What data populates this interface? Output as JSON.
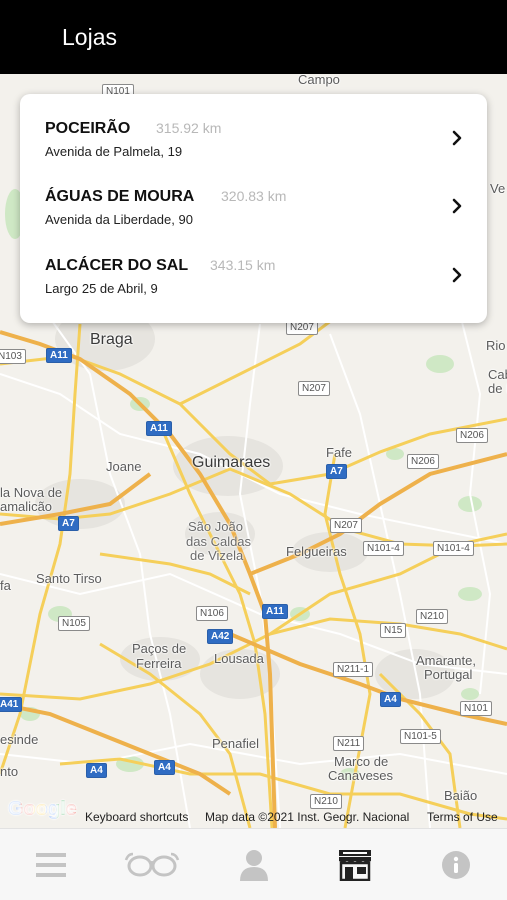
{
  "header": {
    "title": "Lojas"
  },
  "stores": [
    {
      "name": "POCEIRÃO",
      "distance": "315.92 km",
      "address": "Avenida de Palmela, 19"
    },
    {
      "name": "ÁGUAS DE MOURA",
      "distance": "320.83 km",
      "address": "Avenida da Liberdade, 90"
    },
    {
      "name": "ALCÁCER DO SAL",
      "distance": "343.15 km",
      "address": "Largo 25 de Abril, 9"
    }
  ],
  "map": {
    "places": {
      "campo": "Campo",
      "braga": "Braga",
      "guimaraes": "Guimaraes",
      "fafe": "Fafe",
      "joane": "Joane",
      "vila_nova_1": "la Nova de",
      "vila_nova_2": "amalicão",
      "sao_joao_1": "São João",
      "sao_joao_2": "das Caldas",
      "sao_joao_3": "de Vizela",
      "felgueiras": "Felgueiras",
      "santo_tirso": "Santo Tirso",
      "pacos_1": "Paços de",
      "pacos_2": "Ferreira",
      "lousada": "Lousada",
      "amarante_1": "Amarante,",
      "amarante_2": "Portugal",
      "penafiel": "Penafiel",
      "marco_1": "Marco de",
      "marco_2": "Canaveses",
      "baiao": "Baião",
      "rio": "Rio",
      "cabeceiras_1": "Cabece",
      "cabeceiras_2": "de Bas",
      "ve": "Ve",
      "fa": "fa",
      "esinde": "esinde",
      "nto": "nto"
    },
    "shields": {
      "n101_top": "N101",
      "n103": "N103",
      "a11_braga": "A11",
      "n207_top": "N207",
      "n207_mid": "N207",
      "a11_mid": "A11",
      "n206_right": "N206",
      "a7_fafe": "A7",
      "n206_mid": "N206",
      "a7_left": "A7",
      "n207_low": "N207",
      "n101_4a": "N101-4",
      "n101_4b": "N101-4",
      "n105": "N105",
      "n106": "N106",
      "a11_low": "A11",
      "a42": "A42",
      "n15": "N15",
      "n210_right": "N210",
      "n211_1": "N211-1",
      "a4_right": "A4",
      "n101_right": "N101",
      "a41": "A41",
      "n101_5": "N101-5",
      "n211": "N211",
      "a4_left": "A4",
      "a4_mid": "A4",
      "n210_low": "N210"
    },
    "logo": "Google",
    "keyboard_shortcuts": "Keyboard shortcuts",
    "map_data": "Map data ©2021 Inst. Geogr. Nacional",
    "terms": "Terms of Use"
  },
  "tabs": [
    {
      "icon": "menu-icon",
      "label": "Menu"
    },
    {
      "icon": "glasses-icon",
      "label": "Glasses"
    },
    {
      "icon": "profile-icon",
      "label": "Profile"
    },
    {
      "icon": "store-icon",
      "label": "Stores",
      "active": true
    },
    {
      "icon": "info-icon",
      "label": "Info"
    }
  ],
  "colors": {
    "header_bg": "#000000",
    "active_tab": "#222222",
    "inactive_tab": "#c4c4c4",
    "highway_shield": "#2f6cc3",
    "road": "#f7d566"
  }
}
